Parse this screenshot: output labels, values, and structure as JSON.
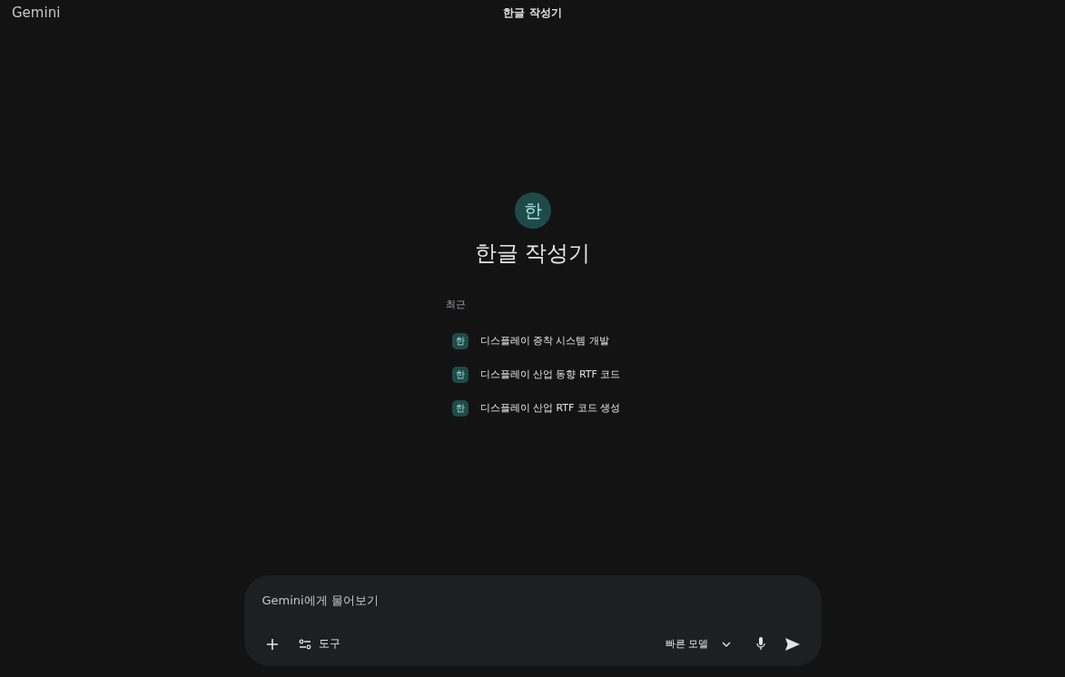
{
  "header": {
    "brand": "Gemini",
    "title": "한글 작성기"
  },
  "gem": {
    "avatar": "한",
    "name": "한글 작성기"
  },
  "recent": {
    "label": "최근",
    "items": [
      {
        "avatar": "한",
        "title": "디스플레이 증착 시스템 개발"
      },
      {
        "avatar": "한",
        "title": "디스플레이 산업 동향 RTF 코드"
      },
      {
        "avatar": "한",
        "title": "디스플레이 산업 RTF 코드 생성"
      }
    ]
  },
  "composer": {
    "placeholder": "Gemini에게 물어보기",
    "tools_label": "도구",
    "model_label": "빠른 모델"
  }
}
